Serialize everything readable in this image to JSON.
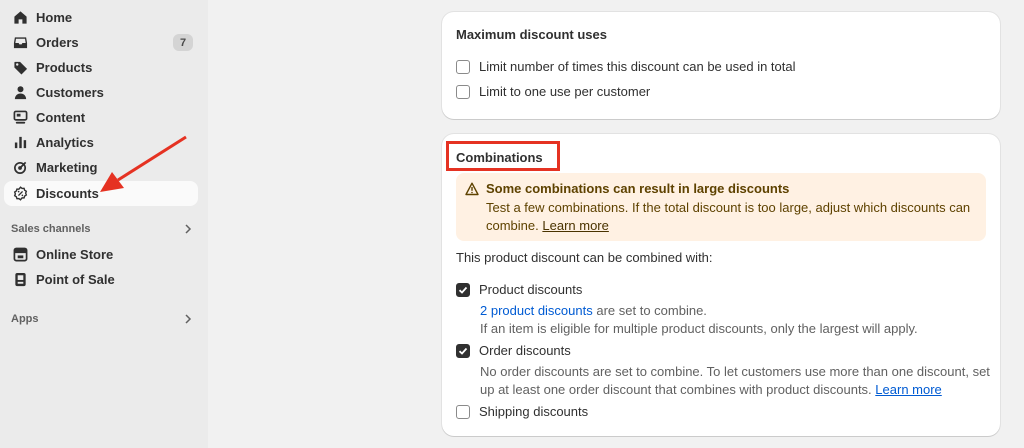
{
  "sidebar": {
    "items": [
      {
        "label": "Home",
        "icon": "home-icon"
      },
      {
        "label": "Orders",
        "icon": "inbox-icon",
        "badge": "7"
      },
      {
        "label": "Products",
        "icon": "tag-icon"
      },
      {
        "label": "Customers",
        "icon": "person-icon"
      },
      {
        "label": "Content",
        "icon": "content-icon"
      },
      {
        "label": "Analytics",
        "icon": "bar-chart-icon"
      },
      {
        "label": "Marketing",
        "icon": "target-icon"
      },
      {
        "label": "Discounts",
        "icon": "discount-icon",
        "active": true
      }
    ],
    "sales_channels": {
      "label": "Sales channels",
      "items": [
        {
          "label": "Online Store",
          "icon": "store-icon"
        },
        {
          "label": "Point of Sale",
          "icon": "pos-icon"
        }
      ]
    },
    "apps": {
      "label": "Apps"
    }
  },
  "max_uses": {
    "title": "Maximum discount uses",
    "options": [
      {
        "label": "Limit number of times this discount can be used in total",
        "checked": false
      },
      {
        "label": "Limit to one use per customer",
        "checked": false
      }
    ]
  },
  "combinations": {
    "title": "Combinations",
    "banner": {
      "title": "Some combinations can result in large discounts",
      "body": "Test a few combinations. If the total discount is too large, adjust which discounts can combine.",
      "link": "Learn more"
    },
    "intro": "This product discount can be combined with:",
    "product": {
      "label": "Product discounts",
      "checked": true,
      "link": "2 product discounts",
      "suffix": "are set to combine.",
      "note": "If an item is eligible for multiple product discounts, only the largest will apply."
    },
    "order": {
      "label": "Order discounts",
      "checked": true,
      "line1": "No order discounts are set to combine. To let customers use more than one discount, set",
      "line2": "up at least one order discount that combines with product discounts.",
      "link": "Learn more"
    },
    "shipping": {
      "label": "Shipping discounts",
      "checked": false
    }
  },
  "colors": {
    "annotation_red": "#e53222",
    "link_blue": "#005bd3",
    "banner_bg": "#fff1e3"
  }
}
